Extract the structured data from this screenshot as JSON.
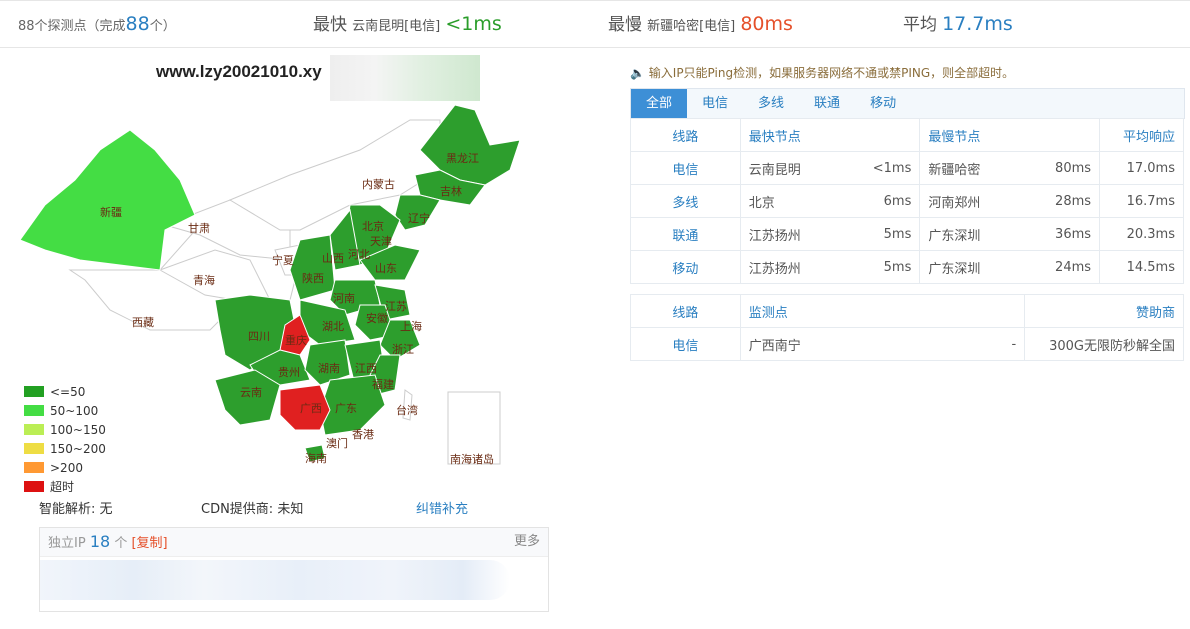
{
  "topbar": {
    "probe_prefix": "88个探测点（完成",
    "probe_done": "88",
    "probe_suffix": "个）",
    "fast_label": "最快",
    "fast_loc": "云南昆明[电信]",
    "fast_val": "<1ms",
    "slow_label": "最慢",
    "slow_loc": "新疆哈密[电信]",
    "slow_val": "80ms",
    "avg_label": "平均",
    "avg_val": "17.7ms"
  },
  "domain": "www.lzy20021010.xy",
  "map_labels": {
    "xinjiang": "新疆",
    "xizang": "西藏",
    "qinghai": "青海",
    "gansu": "甘肃",
    "neimenggu": "内蒙古",
    "heilongjiang": "黑龙江",
    "jilin": "吉林",
    "liaoning": "辽宁",
    "beijing": "北京",
    "tianjin": "天津",
    "hebei": "河北",
    "shanxi": "山西",
    "shandong": "山东",
    "ningxia": "宁夏",
    "shaanxi": "陕西",
    "henan": "河南",
    "jiangsu": "江苏",
    "anhui": "安徽",
    "shanghai": "上海",
    "hubei": "湖北",
    "sichuan": "四川",
    "chongqing": "重庆",
    "zhejiang": "浙江",
    "guizhou": "贵州",
    "hunan": "湖南",
    "jiangxi": "江西",
    "fujian": "福建",
    "yunnan": "云南",
    "guangxi": "广西",
    "guangdong": "广东",
    "taiwan": "台湾",
    "xianggang": "香港",
    "aomen": "澳门",
    "hainan": "海南",
    "nanhai": "南海诸岛"
  },
  "legend": [
    {
      "label": "<=50",
      "color": "#22a022"
    },
    {
      "label": "50~100",
      "color": "#44dd44"
    },
    {
      "label": "100~150",
      "color": "#bbee55"
    },
    {
      "label": "150~200",
      "color": "#eedd44"
    },
    {
      "label": ">200",
      "color": "#ff9933"
    },
    {
      "label": "超时",
      "color": "#dd1111"
    }
  ],
  "colors": {
    "green_dark": "#2d9e2d",
    "green_light": "#44dd44",
    "red": "#e02020"
  },
  "info": {
    "smart_dns": "智能解析: 无",
    "cdn": "CDN提供商: 未知",
    "report": "纠错补充"
  },
  "ip": {
    "label": "独立IP",
    "count": "18",
    "unit": "个",
    "copy": "[复制]",
    "more": "更多"
  },
  "notice": "输入IP只能Ping检测，如果服务器网络不通或禁PING，则全部超时。",
  "tabs": [
    "全部",
    "电信",
    "多线",
    "联通",
    "移动"
  ],
  "result_table": {
    "headers": [
      "线路",
      "最快节点",
      "最慢节点",
      "平均响应"
    ],
    "rows": [
      {
        "line": "电信",
        "fast": "云南昆明",
        "fast_ms": "<1ms",
        "slow": "新疆哈密",
        "slow_ms": "80ms",
        "avg": "17.0ms"
      },
      {
        "line": "多线",
        "fast": "北京",
        "fast_ms": "6ms",
        "slow": "河南郑州",
        "slow_ms": "28ms",
        "avg": "16.7ms"
      },
      {
        "line": "联通",
        "fast": "江苏扬州",
        "fast_ms": "5ms",
        "slow": "广东深圳",
        "slow_ms": "36ms",
        "avg": "20.3ms"
      },
      {
        "line": "移动",
        "fast": "江苏扬州",
        "fast_ms": "5ms",
        "slow": "广东深圳",
        "slow_ms": "24ms",
        "avg": "14.5ms"
      }
    ]
  },
  "monitor_table": {
    "headers": [
      "线路",
      "监测点",
      "",
      "赞助商"
    ],
    "row": {
      "line": "电信",
      "point": "广西南宁",
      "val": "-",
      "sponsor": "300G无限防秒解全国"
    }
  }
}
